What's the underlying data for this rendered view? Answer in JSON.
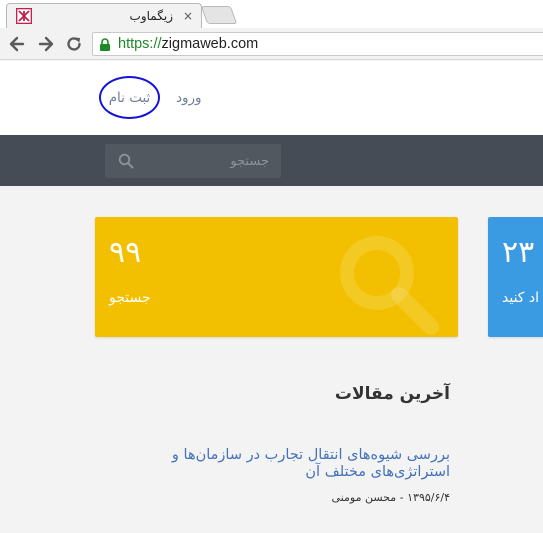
{
  "browser": {
    "tab": {
      "title": "زیگماوب",
      "close": "×"
    },
    "url": {
      "scheme": "https://",
      "host": "zigmaweb.com"
    }
  },
  "header": {
    "login_label": "ورود",
    "register_label": "ثبت نام"
  },
  "search": {
    "placeholder": "جستجو"
  },
  "stats": [
    {
      "count": "۹۹",
      "label": "جستجو",
      "color": "#f2c000"
    },
    {
      "count": "۲۳",
      "label": "اد کنید",
      "color": "#3a9ae2"
    }
  ],
  "articles": {
    "section_title": "آخرین مقالات",
    "items": [
      {
        "title": "بررسی شیوه‌های انتقال تجارب در سازمان‌ها و استراتژی‌های مختلف آن",
        "meta": "۱۳۹۵/۶/۴ - محسن مومنی"
      },
      {
        "title": "... ... ... ..."
      }
    ]
  }
}
